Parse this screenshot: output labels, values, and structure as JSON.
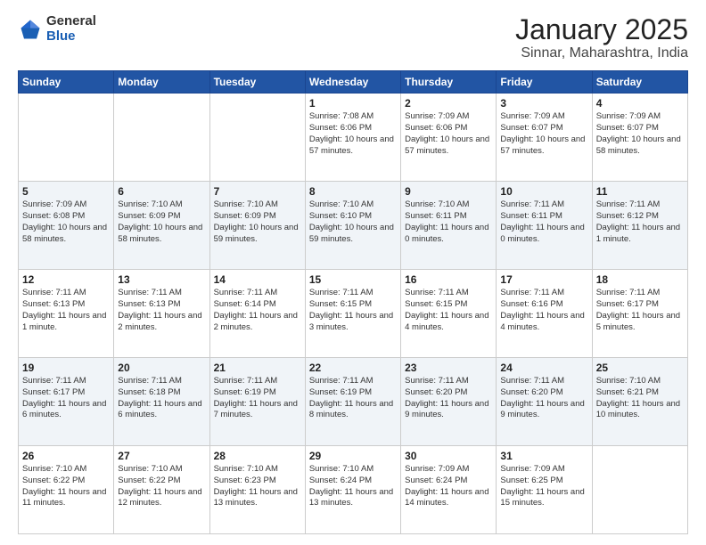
{
  "logo": {
    "general": "General",
    "blue": "Blue"
  },
  "header": {
    "month": "January 2025",
    "location": "Sinnar, Maharashtra, India"
  },
  "weekdays": [
    "Sunday",
    "Monday",
    "Tuesday",
    "Wednesday",
    "Thursday",
    "Friday",
    "Saturday"
  ],
  "weeks": [
    [
      {
        "day": "",
        "sunrise": "",
        "sunset": "",
        "daylight": ""
      },
      {
        "day": "",
        "sunrise": "",
        "sunset": "",
        "daylight": ""
      },
      {
        "day": "",
        "sunrise": "",
        "sunset": "",
        "daylight": ""
      },
      {
        "day": "1",
        "sunrise": "Sunrise: 7:08 AM",
        "sunset": "Sunset: 6:06 PM",
        "daylight": "Daylight: 10 hours and 57 minutes."
      },
      {
        "day": "2",
        "sunrise": "Sunrise: 7:09 AM",
        "sunset": "Sunset: 6:06 PM",
        "daylight": "Daylight: 10 hours and 57 minutes."
      },
      {
        "day": "3",
        "sunrise": "Sunrise: 7:09 AM",
        "sunset": "Sunset: 6:07 PM",
        "daylight": "Daylight: 10 hours and 57 minutes."
      },
      {
        "day": "4",
        "sunrise": "Sunrise: 7:09 AM",
        "sunset": "Sunset: 6:07 PM",
        "daylight": "Daylight: 10 hours and 58 minutes."
      }
    ],
    [
      {
        "day": "5",
        "sunrise": "Sunrise: 7:09 AM",
        "sunset": "Sunset: 6:08 PM",
        "daylight": "Daylight: 10 hours and 58 minutes."
      },
      {
        "day": "6",
        "sunrise": "Sunrise: 7:10 AM",
        "sunset": "Sunset: 6:09 PM",
        "daylight": "Daylight: 10 hours and 58 minutes."
      },
      {
        "day": "7",
        "sunrise": "Sunrise: 7:10 AM",
        "sunset": "Sunset: 6:09 PM",
        "daylight": "Daylight: 10 hours and 59 minutes."
      },
      {
        "day": "8",
        "sunrise": "Sunrise: 7:10 AM",
        "sunset": "Sunset: 6:10 PM",
        "daylight": "Daylight: 10 hours and 59 minutes."
      },
      {
        "day": "9",
        "sunrise": "Sunrise: 7:10 AM",
        "sunset": "Sunset: 6:11 PM",
        "daylight": "Daylight: 11 hours and 0 minutes."
      },
      {
        "day": "10",
        "sunrise": "Sunrise: 7:11 AM",
        "sunset": "Sunset: 6:11 PM",
        "daylight": "Daylight: 11 hours and 0 minutes."
      },
      {
        "day": "11",
        "sunrise": "Sunrise: 7:11 AM",
        "sunset": "Sunset: 6:12 PM",
        "daylight": "Daylight: 11 hours and 1 minute."
      }
    ],
    [
      {
        "day": "12",
        "sunrise": "Sunrise: 7:11 AM",
        "sunset": "Sunset: 6:13 PM",
        "daylight": "Daylight: 11 hours and 1 minute."
      },
      {
        "day": "13",
        "sunrise": "Sunrise: 7:11 AM",
        "sunset": "Sunset: 6:13 PM",
        "daylight": "Daylight: 11 hours and 2 minutes."
      },
      {
        "day": "14",
        "sunrise": "Sunrise: 7:11 AM",
        "sunset": "Sunset: 6:14 PM",
        "daylight": "Daylight: 11 hours and 2 minutes."
      },
      {
        "day": "15",
        "sunrise": "Sunrise: 7:11 AM",
        "sunset": "Sunset: 6:15 PM",
        "daylight": "Daylight: 11 hours and 3 minutes."
      },
      {
        "day": "16",
        "sunrise": "Sunrise: 7:11 AM",
        "sunset": "Sunset: 6:15 PM",
        "daylight": "Daylight: 11 hours and 4 minutes."
      },
      {
        "day": "17",
        "sunrise": "Sunrise: 7:11 AM",
        "sunset": "Sunset: 6:16 PM",
        "daylight": "Daylight: 11 hours and 4 minutes."
      },
      {
        "day": "18",
        "sunrise": "Sunrise: 7:11 AM",
        "sunset": "Sunset: 6:17 PM",
        "daylight": "Daylight: 11 hours and 5 minutes."
      }
    ],
    [
      {
        "day": "19",
        "sunrise": "Sunrise: 7:11 AM",
        "sunset": "Sunset: 6:17 PM",
        "daylight": "Daylight: 11 hours and 6 minutes."
      },
      {
        "day": "20",
        "sunrise": "Sunrise: 7:11 AM",
        "sunset": "Sunset: 6:18 PM",
        "daylight": "Daylight: 11 hours and 6 minutes."
      },
      {
        "day": "21",
        "sunrise": "Sunrise: 7:11 AM",
        "sunset": "Sunset: 6:19 PM",
        "daylight": "Daylight: 11 hours and 7 minutes."
      },
      {
        "day": "22",
        "sunrise": "Sunrise: 7:11 AM",
        "sunset": "Sunset: 6:19 PM",
        "daylight": "Daylight: 11 hours and 8 minutes."
      },
      {
        "day": "23",
        "sunrise": "Sunrise: 7:11 AM",
        "sunset": "Sunset: 6:20 PM",
        "daylight": "Daylight: 11 hours and 9 minutes."
      },
      {
        "day": "24",
        "sunrise": "Sunrise: 7:11 AM",
        "sunset": "Sunset: 6:20 PM",
        "daylight": "Daylight: 11 hours and 9 minutes."
      },
      {
        "day": "25",
        "sunrise": "Sunrise: 7:10 AM",
        "sunset": "Sunset: 6:21 PM",
        "daylight": "Daylight: 11 hours and 10 minutes."
      }
    ],
    [
      {
        "day": "26",
        "sunrise": "Sunrise: 7:10 AM",
        "sunset": "Sunset: 6:22 PM",
        "daylight": "Daylight: 11 hours and 11 minutes."
      },
      {
        "day": "27",
        "sunrise": "Sunrise: 7:10 AM",
        "sunset": "Sunset: 6:22 PM",
        "daylight": "Daylight: 11 hours and 12 minutes."
      },
      {
        "day": "28",
        "sunrise": "Sunrise: 7:10 AM",
        "sunset": "Sunset: 6:23 PM",
        "daylight": "Daylight: 11 hours and 13 minutes."
      },
      {
        "day": "29",
        "sunrise": "Sunrise: 7:10 AM",
        "sunset": "Sunset: 6:24 PM",
        "daylight": "Daylight: 11 hours and 13 minutes."
      },
      {
        "day": "30",
        "sunrise": "Sunrise: 7:09 AM",
        "sunset": "Sunset: 6:24 PM",
        "daylight": "Daylight: 11 hours and 14 minutes."
      },
      {
        "day": "31",
        "sunrise": "Sunrise: 7:09 AM",
        "sunset": "Sunset: 6:25 PM",
        "daylight": "Daylight: 11 hours and 15 minutes."
      },
      {
        "day": "",
        "sunrise": "",
        "sunset": "",
        "daylight": ""
      }
    ]
  ]
}
